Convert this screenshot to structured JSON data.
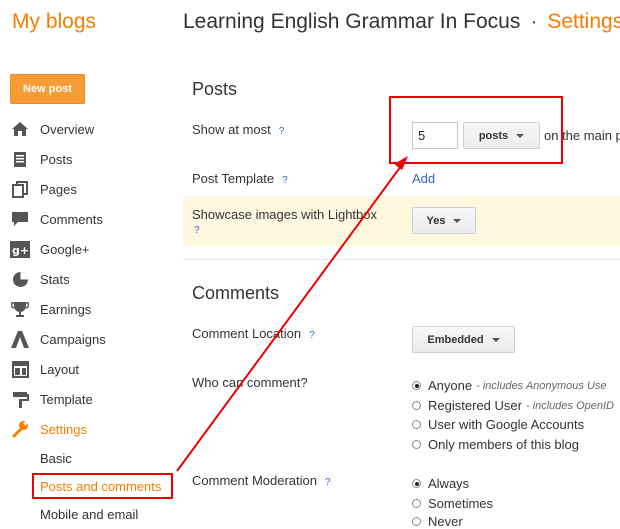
{
  "header": {
    "app_title": "My blogs",
    "blog_name": "Learning English Grammar In Focus",
    "separator": "·",
    "section": "Settings"
  },
  "sidebar": {
    "new_post": "New post",
    "items": [
      {
        "label": "Overview",
        "icon": "overview-icon"
      },
      {
        "label": "Posts",
        "icon": "posts-icon"
      },
      {
        "label": "Pages",
        "icon": "pages-icon"
      },
      {
        "label": "Comments",
        "icon": "comments-icon"
      },
      {
        "label": "Google+",
        "icon": "googleplus-icon"
      },
      {
        "label": "Stats",
        "icon": "stats-icon"
      },
      {
        "label": "Earnings",
        "icon": "earnings-icon"
      },
      {
        "label": "Campaigns",
        "icon": "campaigns-icon"
      },
      {
        "label": "Layout",
        "icon": "layout-icon"
      },
      {
        "label": "Template",
        "icon": "template-icon"
      },
      {
        "label": "Settings",
        "icon": "wrench-icon"
      }
    ],
    "sub_items": [
      "Basic",
      "Posts and comments",
      "Mobile and email"
    ]
  },
  "posts": {
    "heading": "Posts",
    "show_at_most_label": "Show at most",
    "show_at_most_value": "5",
    "unit_select": "posts",
    "unit_suffix": "on the main p",
    "post_template_label": "Post Template",
    "post_template_link": "Add",
    "lightbox_label": "Showcase images with Lightbox",
    "lightbox_value": "Yes",
    "help": "?"
  },
  "comments": {
    "heading": "Comments",
    "location_label": "Comment Location",
    "location_value": "Embedded",
    "who_label": "Who can comment?",
    "who_options": [
      {
        "label": "Anyone",
        "note": "- includes Anonymous Use",
        "selected": true
      },
      {
        "label": "Registered User",
        "note": "- includes OpenID",
        "selected": false
      },
      {
        "label": "User with Google Accounts",
        "note": "",
        "selected": false
      },
      {
        "label": "Only members of this blog",
        "note": "",
        "selected": false
      }
    ],
    "moderation_label": "Comment Moderation",
    "moderation_options": [
      {
        "label": "Always",
        "selected": true
      },
      {
        "label": "Sometimes",
        "selected": false
      },
      {
        "label": "Never",
        "selected": false
      }
    ]
  },
  "colors": {
    "accent": "#f57d00",
    "annotation": "#e00000",
    "link": "#3366cc"
  }
}
